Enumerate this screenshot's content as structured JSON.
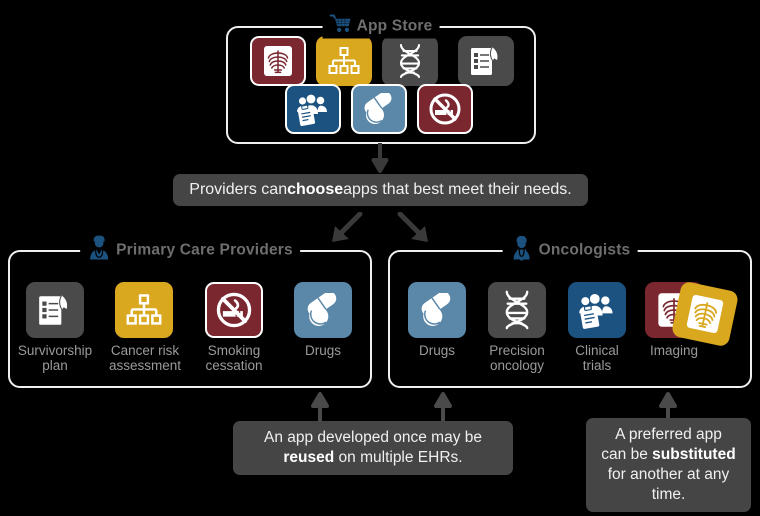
{
  "appstore": {
    "title": "App Store",
    "icon": "shopping-cart-icon",
    "tiles": [
      {
        "name": "xray-chest-icon",
        "color": "#7a2730",
        "framed": true,
        "glyph": "ribcage"
      },
      {
        "name": "hierarchy-chart-icon",
        "color": "#d9a81f",
        "framed": false,
        "glyph": "orgchart"
      },
      {
        "name": "dna-helix-icon",
        "color": "#4a4a4a",
        "framed": false,
        "glyph": "dna"
      },
      {
        "name": "clipboard-ribbon-icon",
        "color": "#4a4a4a",
        "framed": false,
        "glyph": "ribbonlist"
      },
      {
        "name": "clinical-trials-people-icon",
        "color": "#1c5280",
        "framed": true,
        "glyph": "people"
      },
      {
        "name": "drugs-pills-icon",
        "color": "#5b87a8",
        "framed": true,
        "glyph": "pills"
      },
      {
        "name": "no-smoking-icon",
        "color": "#7a2730",
        "framed": true,
        "glyph": "nosmoking"
      }
    ]
  },
  "banner": {
    "prefix": "Providers can ",
    "bold": "choose",
    "suffix": " apps that best meet their needs."
  },
  "panels": [
    {
      "id": "primary-care-providers",
      "title": "Primary Care Providers",
      "icon": "doctor-icon",
      "apps": [
        {
          "label": "Survivorship\nplan",
          "name": "app-survivorship-plan",
          "color": "#4a4a4a",
          "framed": false,
          "glyph": "ribbonlist"
        },
        {
          "label": "Cancer risk\nassessment",
          "name": "app-cancer-risk-assessment",
          "color": "#d9a81f",
          "framed": false,
          "glyph": "orgchart"
        },
        {
          "label": "Smoking\ncessation",
          "name": "app-smoking-cessation",
          "color": "#7a2730",
          "framed": true,
          "glyph": "nosmoking"
        },
        {
          "label": "Drugs",
          "name": "app-drugs",
          "color": "#5b87a8",
          "framed": false,
          "glyph": "pills"
        }
      ]
    },
    {
      "id": "oncologists",
      "title": "Oncologists",
      "icon": "oncologist-icon",
      "apps": [
        {
          "label": "Drugs",
          "name": "app-drugs",
          "color": "#5b87a8",
          "framed": false,
          "glyph": "pills"
        },
        {
          "label": "Precision\noncology",
          "name": "app-precision-oncology",
          "color": "#4a4a4a",
          "framed": false,
          "glyph": "dna"
        },
        {
          "label": "Clinical\ntrials",
          "name": "app-clinical-trials",
          "color": "#1c5280",
          "framed": false,
          "glyph": "people"
        },
        {
          "label": "Imaging",
          "name": "app-imaging",
          "color": "#7a2730",
          "framed": false,
          "glyph": "ribcage",
          "substitute": {
            "color": "#d9a81f",
            "name": "app-imaging-substitute"
          }
        }
      ]
    }
  ],
  "notes": [
    {
      "id": "reuse-note",
      "line1_prefix": "An app developed once may be",
      "line2_bold": "reused",
      "line2_suffix": " on multiple EHRs."
    },
    {
      "id": "substitute-note",
      "line1": "A preferred app",
      "line2_prefix": "can be ",
      "line2_bold": "substituted",
      "line3": "for another at any",
      "line4": "time."
    }
  ],
  "colors": {
    "background": "#000000",
    "outline": "#efefef",
    "callout_bg": "#454545",
    "label_gray": "#9a9a9a",
    "title_gray": "#6e6e6e",
    "brand_blue": "#1c5280",
    "arrow_gray": "#3a3a3a"
  }
}
